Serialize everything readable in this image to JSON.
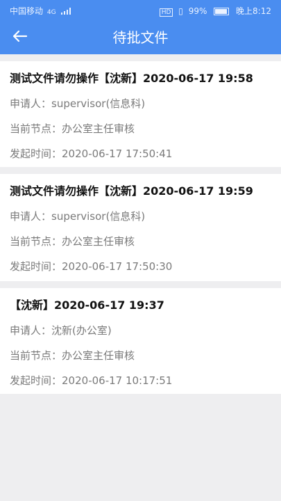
{
  "status_bar": {
    "carrier": "中国移动",
    "network": "4G",
    "battery": "99%",
    "time": "晚上8:12"
  },
  "header": {
    "title": "待批文件"
  },
  "items": [
    {
      "title": "测试文件请勿操作【沈新】2020-06-17 19:58",
      "applicant_label": "申请人：",
      "applicant": "supervisor(信息科)",
      "node_label": "当前节点：",
      "node": "办公室主任审核",
      "time_label": "发起时间：",
      "time": "2020-06-17 17:50:41"
    },
    {
      "title": "测试文件请勿操作【沈新】2020-06-17 19:59",
      "applicant_label": "申请人：",
      "applicant": "supervisor(信息科)",
      "node_label": "当前节点：",
      "node": "办公室主任审核",
      "time_label": "发起时间：",
      "time": "2020-06-17 17:50:30"
    },
    {
      "title": "【沈新】2020-06-17 19:37",
      "applicant_label": "申请人：",
      "applicant": "沈新(办公室)",
      "node_label": "当前节点：",
      "node": "办公室主任审核",
      "time_label": "发起时间：",
      "time": "2020-06-17 10:17:51"
    }
  ],
  "colors": {
    "primary": "#4a8df0",
    "background": "#eeeef0"
  }
}
